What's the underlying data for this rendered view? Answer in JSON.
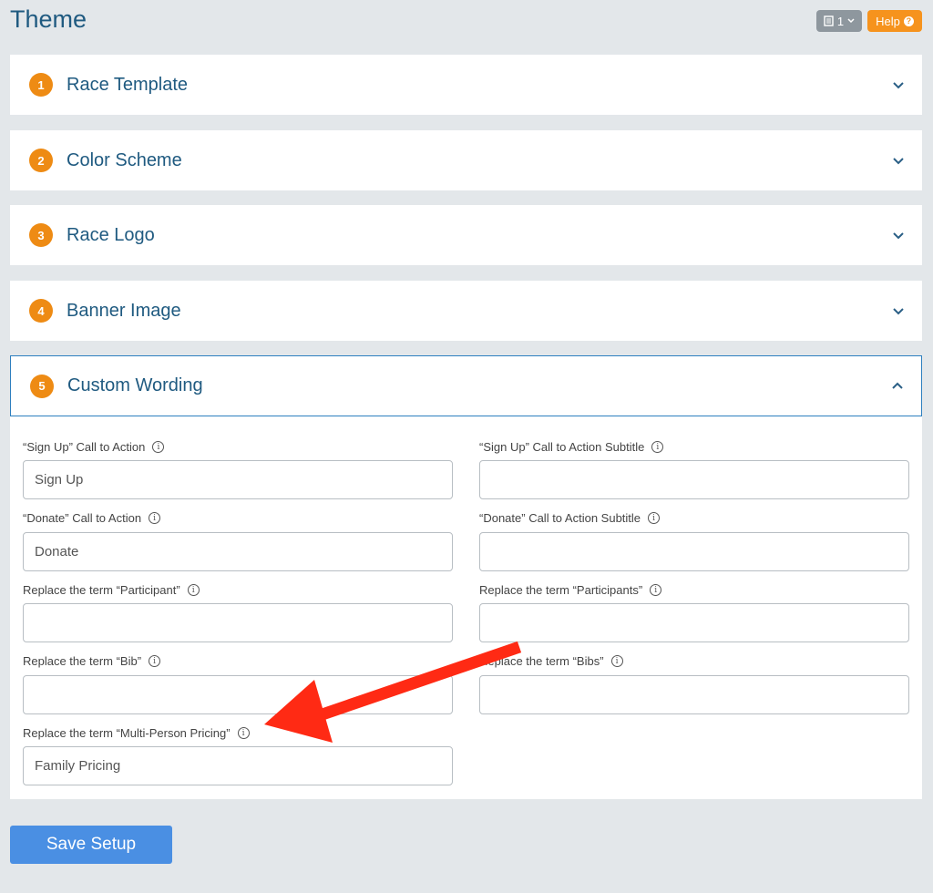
{
  "page": {
    "title": "Theme"
  },
  "toolbar": {
    "count_label": "1",
    "help_label": "Help"
  },
  "sections": [
    {
      "number": "1",
      "title": "Race Template"
    },
    {
      "number": "2",
      "title": "Color Scheme"
    },
    {
      "number": "3",
      "title": "Race Logo"
    },
    {
      "number": "4",
      "title": "Banner Image"
    },
    {
      "number": "5",
      "title": "Custom Wording"
    }
  ],
  "fields": [
    {
      "label": "“Sign Up” Call to Action",
      "value": "Sign Up"
    },
    {
      "label": "“Sign Up” Call to Action Subtitle",
      "value": ""
    },
    {
      "label": "“Donate” Call to Action",
      "value": "Donate"
    },
    {
      "label": "“Donate” Call to Action Subtitle",
      "value": ""
    },
    {
      "label": "Replace the term “Participant”",
      "value": ""
    },
    {
      "label": "Replace the term “Participants”",
      "value": ""
    },
    {
      "label": "Replace the term “Bib”",
      "value": ""
    },
    {
      "label": "Replace the term “Bibs”",
      "value": ""
    },
    {
      "label": "Replace the term “Multi-Person Pricing”",
      "value": "Family Pricing"
    }
  ],
  "save_button": {
    "label": "Save Setup"
  },
  "colors": {
    "accent": "#ee8b14",
    "title": "#1f5a80",
    "save": "#4a8fe3",
    "arrow": "#ff2a14"
  },
  "icons": {
    "chevron_down": "chevron-down-icon",
    "chevron_up": "chevron-up-icon",
    "info": "info-icon",
    "arrow": "annotation-arrow"
  }
}
